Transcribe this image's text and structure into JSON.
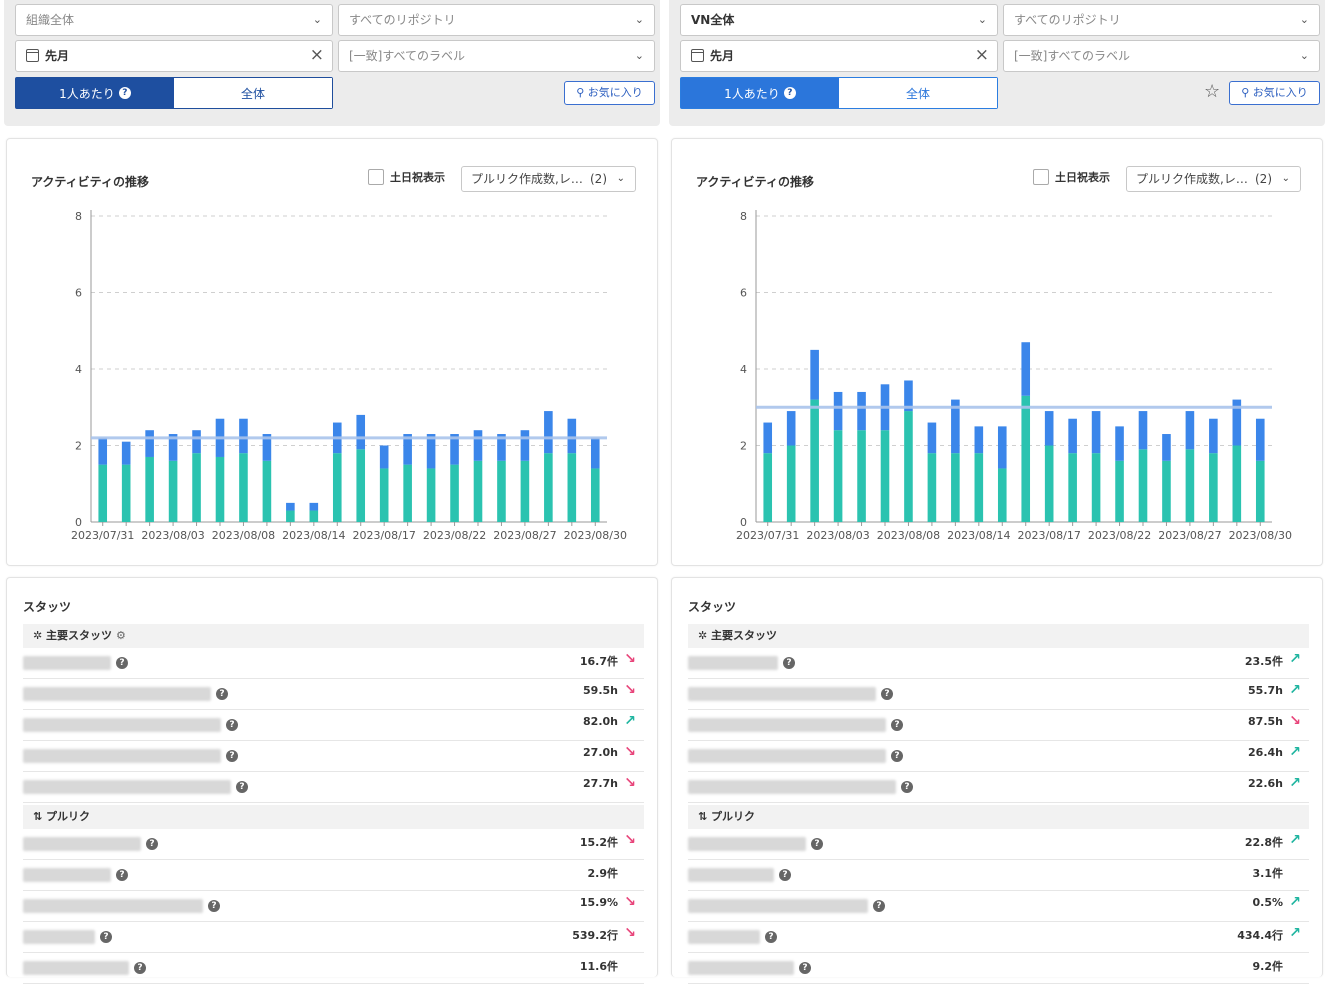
{
  "panels": [
    {
      "filters": {
        "org": "組織全体",
        "repo": "すべてのリポジトリ",
        "period": "先月",
        "label": "[一致]すべてのラベル",
        "toggle_per_person": "1人あたり",
        "toggle_total": "全体",
        "favorite": "お気に入り"
      },
      "chart_title": "アクティビティの推移",
      "holiday_label": "土日祝表示",
      "metric_select": "プルリク作成数,レ…",
      "metric_count": "(2)",
      "stats_title": "スタッツ",
      "sections": [
        {
          "title": "主要スタッツ",
          "icon": "pin-icon",
          "rows": [
            {
              "value": "16.7件",
              "trend": "down"
            },
            {
              "value": "59.5h",
              "trend": "down"
            },
            {
              "value": "82.0h",
              "trend": "up"
            },
            {
              "value": "27.0h",
              "trend": "down"
            },
            {
              "value": "27.7h",
              "trend": "down"
            }
          ]
        },
        {
          "title": "プルリク",
          "icon": "pull-request-icon",
          "rows": [
            {
              "value": "15.2件",
              "trend": "down"
            },
            {
              "value": "2.9件",
              "trend": "none"
            },
            {
              "value": "15.9%",
              "trend": "down"
            },
            {
              "value": "539.2行",
              "trend": "down"
            },
            {
              "value": "11.6件",
              "trend": "none"
            }
          ]
        }
      ]
    },
    {
      "filters": {
        "org": "VN全体",
        "repo": "すべてのリポジトリ",
        "period": "先月",
        "label": "[一致]すべてのラベル",
        "toggle_per_person": "1人あたり",
        "toggle_total": "全体",
        "favorite": "お気に入り"
      },
      "chart_title": "アクティビティの推移",
      "holiday_label": "土日祝表示",
      "metric_select": "プルリク作成数,レ…",
      "metric_count": "(2)",
      "stats_title": "スタッツ",
      "sections": [
        {
          "title": "主要スタッツ",
          "icon": "pin-icon",
          "rows": [
            {
              "value": "23.5件",
              "trend": "up"
            },
            {
              "value": "55.7h",
              "trend": "up"
            },
            {
              "value": "87.5h",
              "trend": "down"
            },
            {
              "value": "26.4h",
              "trend": "up"
            },
            {
              "value": "22.6h",
              "trend": "up"
            }
          ]
        },
        {
          "title": "プルリク",
          "icon": "pull-request-icon",
          "rows": [
            {
              "value": "22.8件",
              "trend": "up"
            },
            {
              "value": "3.1件",
              "trend": "none"
            },
            {
              "value": "0.5%",
              "trend": "up"
            },
            {
              "value": "434.4行",
              "trend": "up"
            },
            {
              "value": "9.2件",
              "trend": "none"
            }
          ]
        }
      ]
    }
  ],
  "colors": {
    "bar_top": "#3b86ea",
    "bar_bottom": "#2bc3b0",
    "avg_line": "#a9c4ec",
    "down": "#e8447a",
    "up": "#1fb5a0"
  },
  "chart_data": [
    {
      "type": "bar",
      "stacked": true,
      "ylim": [
        0,
        8
      ],
      "yticks": [
        0,
        2,
        4,
        6,
        8
      ],
      "average": 2.2,
      "grid": true,
      "x_tick_labels": [
        "2023/07/31",
        "2023/08/03",
        "2023/08/08",
        "2023/08/14",
        "2023/08/17",
        "2023/08/22",
        "2023/08/27",
        "2023/08/30"
      ],
      "x_tick_index": [
        0,
        3,
        6,
        9,
        12,
        15,
        18,
        21
      ],
      "series": [
        {
          "values": [
            1.5,
            1.5,
            1.7,
            1.6,
            1.8,
            1.7,
            1.8,
            1.6,
            0.3,
            0.3,
            1.8,
            1.9,
            1.4,
            1.5,
            1.4,
            1.5,
            1.6,
            1.6,
            1.6,
            1.8,
            1.8,
            1.4
          ]
        },
        {
          "values": [
            0.7,
            0.6,
            0.7,
            0.7,
            0.6,
            1.0,
            0.9,
            0.7,
            0.2,
            0.2,
            0.8,
            0.9,
            0.6,
            0.8,
            0.9,
            0.8,
            0.8,
            0.7,
            0.8,
            1.1,
            0.9,
            0.8
          ]
        }
      ]
    },
    {
      "type": "bar",
      "stacked": true,
      "ylim": [
        0,
        8
      ],
      "yticks": [
        0,
        2,
        4,
        6,
        8
      ],
      "average": 3.0,
      "grid": true,
      "x_tick_labels": [
        "2023/07/31",
        "2023/08/03",
        "2023/08/08",
        "2023/08/14",
        "2023/08/17",
        "2023/08/22",
        "2023/08/27",
        "2023/08/30"
      ],
      "x_tick_index": [
        0,
        3,
        6,
        9,
        12,
        15,
        18,
        21
      ],
      "series": [
        {
          "values": [
            1.8,
            2.0,
            3.2,
            2.4,
            2.4,
            2.4,
            2.9,
            1.8,
            1.8,
            1.8,
            1.4,
            3.3,
            2.0,
            1.8,
            1.8,
            1.6,
            1.9,
            1.6,
            1.9,
            1.8,
            2.0,
            1.6
          ]
        },
        {
          "values": [
            0.8,
            0.9,
            1.3,
            1.0,
            1.0,
            1.2,
            0.8,
            0.8,
            1.4,
            0.7,
            1.1,
            1.4,
            0.9,
            0.9,
            1.1,
            0.9,
            1.0,
            0.7,
            1.0,
            0.9,
            1.2,
            1.1
          ]
        }
      ]
    }
  ]
}
